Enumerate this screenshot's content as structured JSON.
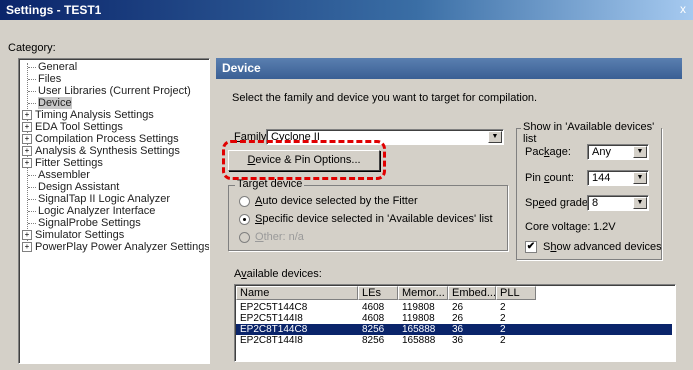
{
  "window": {
    "title": "Settings - TEST1",
    "close_glyph": "x"
  },
  "category_label": "Category:",
  "tree": [
    {
      "label": "General",
      "indent": 1,
      "expander": "",
      "selected": false
    },
    {
      "label": "Files",
      "indent": 1,
      "expander": "",
      "selected": false
    },
    {
      "label": "User Libraries (Current Project)",
      "indent": 1,
      "expander": "",
      "selected": false
    },
    {
      "label": "Device",
      "indent": 1,
      "expander": "",
      "selected": true
    },
    {
      "label": "Timing Analysis Settings",
      "indent": 0,
      "expander": "+",
      "selected": false
    },
    {
      "label": "EDA Tool Settings",
      "indent": 0,
      "expander": "+",
      "selected": false
    },
    {
      "label": "Compilation Process Settings",
      "indent": 0,
      "expander": "+",
      "selected": false
    },
    {
      "label": "Analysis & Synthesis Settings",
      "indent": 0,
      "expander": "+",
      "selected": false
    },
    {
      "label": "Fitter Settings",
      "indent": 0,
      "expander": "+",
      "selected": false
    },
    {
      "label": "Assembler",
      "indent": 1,
      "expander": "",
      "selected": false
    },
    {
      "label": "Design Assistant",
      "indent": 1,
      "expander": "",
      "selected": false
    },
    {
      "label": "SignalTap II Logic Analyzer",
      "indent": 1,
      "expander": "",
      "selected": false
    },
    {
      "label": "Logic Analyzer Interface",
      "indent": 1,
      "expander": "",
      "selected": false
    },
    {
      "label": "SignalProbe Settings",
      "indent": 1,
      "expander": "",
      "selected": false
    },
    {
      "label": "Simulator Settings",
      "indent": 0,
      "expander": "+",
      "selected": false
    },
    {
      "label": "PowerPlay Power Analyzer Settings",
      "indent": 0,
      "expander": "+",
      "selected": false
    }
  ],
  "panel": {
    "heading": "Device",
    "description": "Select the family and device you want to target for compilation.",
    "family": {
      "label_pre": "",
      "label_u": "F",
      "label_post": "amily:",
      "value": "Cyclone II"
    },
    "pin_options_button": {
      "pre": "",
      "u": "D",
      "post": "evice & Pin Options..."
    },
    "target_device": {
      "title": "Target device",
      "options": [
        {
          "pre": "",
          "u": "A",
          "post": "uto device selected by the Fitter",
          "selected": false,
          "disabled": false
        },
        {
          "pre": "",
          "u": "S",
          "post": "pecific device selected in 'Available devices' list",
          "selected": true,
          "disabled": false
        },
        {
          "pre": "",
          "u": "O",
          "post": "ther:  n/a",
          "selected": false,
          "disabled": true
        }
      ]
    },
    "filter": {
      "title": "Show in 'Available devices' list",
      "package": {
        "pre": "Pac",
        "u": "k",
        "post": "age:",
        "value": "Any"
      },
      "pin_count": {
        "pre": "Pin ",
        "u": "c",
        "post": "ount:",
        "value": "144"
      },
      "speed_grade": {
        "pre": "Sp",
        "u": "e",
        "post": "ed grade:",
        "value": "8"
      },
      "core_voltage_label": "Core voltage:",
      "core_voltage_value": "1.2V",
      "show_advanced": {
        "pre": "S",
        "u": "h",
        "post": "ow advanced devices",
        "checked": true,
        "check_glyph": "✔"
      }
    },
    "available_devices": {
      "label_pre": "A",
      "label_u": "v",
      "label_post": "ailable devices:",
      "columns": [
        "Name",
        "LEs",
        "Memor...",
        "Embed...",
        "PLL"
      ],
      "rows": [
        {
          "cells": [
            "EP2C5T144C8",
            "4608",
            "119808",
            "26",
            "2"
          ],
          "selected": false
        },
        {
          "cells": [
            "EP2C5T144I8",
            "4608",
            "119808",
            "26",
            "2"
          ],
          "selected": false
        },
        {
          "cells": [
            "EP2C8T144C8",
            "8256",
            "165888",
            "36",
            "2"
          ],
          "selected": true
        },
        {
          "cells": [
            "EP2C8T144I8",
            "8256",
            "165888",
            "36",
            "2"
          ],
          "selected": false
        }
      ]
    }
  },
  "icons": {
    "dropdown": "chevron-down-icon",
    "expand": "plus-icon"
  },
  "colors": {
    "title_bar": "#0a246a",
    "panel_header": "#4a6fa5",
    "selection": "#0a246a",
    "annotation": "#e00000"
  }
}
